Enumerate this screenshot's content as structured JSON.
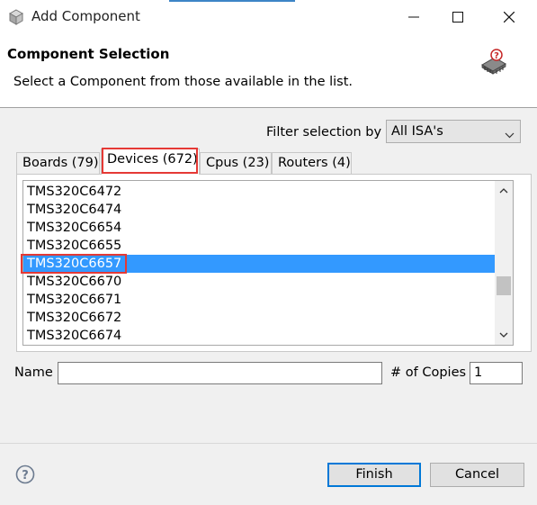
{
  "window": {
    "title": "Add Component",
    "buttons": {
      "minimize": "—",
      "maximize": "☐",
      "close": "✕"
    }
  },
  "header": {
    "title": "Component Selection",
    "description": "Select a Component from those available in the list.",
    "icon": "chip-help-icon"
  },
  "filter": {
    "label": "Filter selection by",
    "value": "All ISA's"
  },
  "tabs": [
    {
      "label": "Boards (79)",
      "active": false
    },
    {
      "label": "Devices (672)",
      "active": true
    },
    {
      "label": "Cpus (23)",
      "active": false
    },
    {
      "label": "Routers (4)",
      "active": false
    }
  ],
  "list": {
    "items": [
      "TMS320C6472",
      "TMS320C6474",
      "TMS320C6654",
      "TMS320C6655",
      "TMS320C6657",
      "TMS320C6670",
      "TMS320C6671",
      "TMS320C6672",
      "TMS320C6674"
    ],
    "selected": "TMS320C6657"
  },
  "form": {
    "name_label": "Name",
    "name_value": "",
    "copies_label": "# of Copies",
    "copies_value": "1"
  },
  "footer": {
    "finish_label": "Finish",
    "cancel_label": "Cancel",
    "help_icon": "help-icon"
  },
  "colors": {
    "selection": "#3399ff",
    "highlight_box": "#e53935",
    "default_button_border": "#0078d7"
  }
}
